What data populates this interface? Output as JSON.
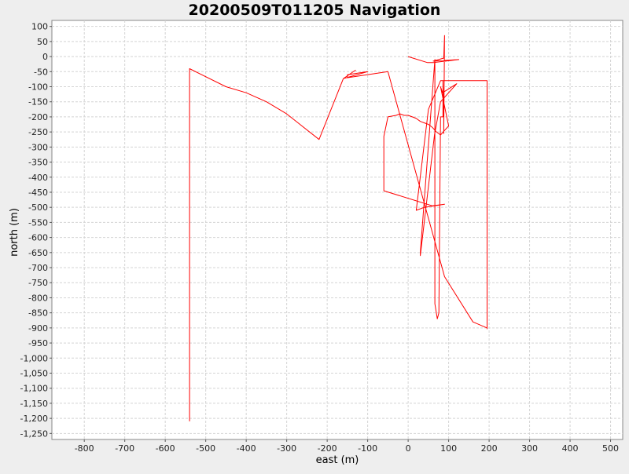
{
  "chart_data": {
    "type": "line",
    "title": "20200509T011205 Navigation",
    "xlabel": "east (m)",
    "ylabel": "north (m)",
    "xlim": [
      -880,
      530
    ],
    "ylim": [
      -1270,
      120
    ],
    "x_ticks": [
      -800,
      -700,
      -600,
      -500,
      -400,
      -300,
      -200,
      -100,
      0,
      100,
      200,
      300,
      400,
      500
    ],
    "x_tick_labels": [
      "-800",
      "-700",
      "-600",
      "-500",
      "-400",
      "-300",
      "-200",
      "-100",
      "0",
      "100",
      "200",
      "300",
      "400",
      "500"
    ],
    "y_ticks": [
      100,
      50,
      0,
      -50,
      -100,
      -150,
      -200,
      -250,
      -300,
      -350,
      -400,
      -450,
      -500,
      -550,
      -600,
      -650,
      -700,
      -750,
      -800,
      -850,
      -900,
      -950,
      -1000,
      -1050,
      -1100,
      -1150,
      -1200,
      -1250
    ],
    "y_tick_labels": [
      "100",
      "50",
      "0",
      "-50",
      "-100",
      "-150",
      "-200",
      "-250",
      "-300",
      "-350",
      "-400",
      "-450",
      "-500",
      "-550",
      "-600",
      "-650",
      "-700",
      "-750",
      "-800",
      "-850",
      "-900",
      "-950",
      "-1,000",
      "-1,050",
      "-1,100",
      "-1,150",
      "-1,200",
      "-1,250"
    ],
    "grid": true,
    "series": [
      {
        "color": "#ff0000",
        "x": [
          0,
          48,
          62,
          125,
          62,
          88,
          90,
          88,
          88,
          86,
          86,
          80,
          76,
          72,
          66,
          66,
          30,
          30,
          65,
          80,
          120,
          85,
          80,
          100,
          90,
          80,
          70,
          60,
          50,
          40,
          30,
          20,
          10,
          0,
          -10,
          -20,
          -30,
          -50,
          -60,
          -60,
          -60,
          -60,
          60,
          90,
          40,
          20,
          50,
          80,
          100,
          120,
          160,
          195,
          195,
          195,
          195,
          195,
          160,
          90,
          -50,
          -150,
          -150,
          -100,
          -100,
          -160,
          -130,
          -160,
          -220,
          -300,
          -350,
          -400,
          -450,
          -540,
          -540
        ],
        "y": [
          0,
          -20,
          -20,
          -10,
          -15,
          -5,
          70,
          -255,
          -200,
          -80,
          -200,
          -200,
          -850,
          -870,
          -820,
          -10,
          -650,
          -660,
          -260,
          -150,
          -90,
          -120,
          -100,
          -230,
          -245,
          -260,
          -250,
          -235,
          -225,
          -220,
          -215,
          -205,
          -200,
          -195,
          -195,
          -190,
          -195,
          -200,
          -265,
          -265,
          -445,
          -445,
          -495,
          -490,
          -500,
          -510,
          -175,
          -80,
          -80,
          -80,
          -80,
          -80,
          -80,
          -85,
          -903,
          -900,
          -880,
          -730,
          -50,
          -70,
          -60,
          -50,
          -50,
          -73,
          -45,
          -73,
          -275,
          -190,
          -150,
          -120,
          -100,
          -40,
          -1210
        ]
      }
    ]
  }
}
